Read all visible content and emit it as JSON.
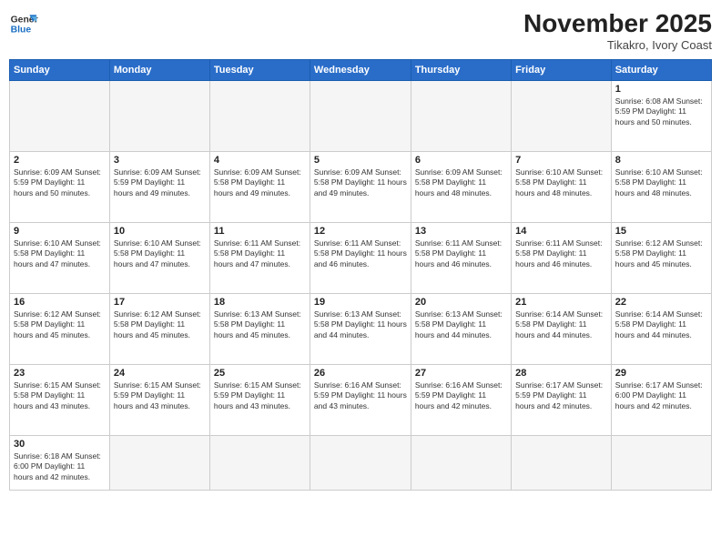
{
  "logo": {
    "general": "General",
    "blue": "Blue"
  },
  "header": {
    "title": "November 2025",
    "location": "Tikakro, Ivory Coast"
  },
  "weekdays": [
    "Sunday",
    "Monday",
    "Tuesday",
    "Wednesday",
    "Thursday",
    "Friday",
    "Saturday"
  ],
  "weeks": [
    [
      {
        "day": "",
        "info": ""
      },
      {
        "day": "",
        "info": ""
      },
      {
        "day": "",
        "info": ""
      },
      {
        "day": "",
        "info": ""
      },
      {
        "day": "",
        "info": ""
      },
      {
        "day": "",
        "info": ""
      },
      {
        "day": "1",
        "info": "Sunrise: 6:08 AM\nSunset: 5:59 PM\nDaylight: 11 hours\nand 50 minutes."
      }
    ],
    [
      {
        "day": "2",
        "info": "Sunrise: 6:09 AM\nSunset: 5:59 PM\nDaylight: 11 hours\nand 50 minutes."
      },
      {
        "day": "3",
        "info": "Sunrise: 6:09 AM\nSunset: 5:59 PM\nDaylight: 11 hours\nand 49 minutes."
      },
      {
        "day": "4",
        "info": "Sunrise: 6:09 AM\nSunset: 5:58 PM\nDaylight: 11 hours\nand 49 minutes."
      },
      {
        "day": "5",
        "info": "Sunrise: 6:09 AM\nSunset: 5:58 PM\nDaylight: 11 hours\nand 49 minutes."
      },
      {
        "day": "6",
        "info": "Sunrise: 6:09 AM\nSunset: 5:58 PM\nDaylight: 11 hours\nand 48 minutes."
      },
      {
        "day": "7",
        "info": "Sunrise: 6:10 AM\nSunset: 5:58 PM\nDaylight: 11 hours\nand 48 minutes."
      },
      {
        "day": "8",
        "info": "Sunrise: 6:10 AM\nSunset: 5:58 PM\nDaylight: 11 hours\nand 48 minutes."
      }
    ],
    [
      {
        "day": "9",
        "info": "Sunrise: 6:10 AM\nSunset: 5:58 PM\nDaylight: 11 hours\nand 47 minutes."
      },
      {
        "day": "10",
        "info": "Sunrise: 6:10 AM\nSunset: 5:58 PM\nDaylight: 11 hours\nand 47 minutes."
      },
      {
        "day": "11",
        "info": "Sunrise: 6:11 AM\nSunset: 5:58 PM\nDaylight: 11 hours\nand 47 minutes."
      },
      {
        "day": "12",
        "info": "Sunrise: 6:11 AM\nSunset: 5:58 PM\nDaylight: 11 hours\nand 46 minutes."
      },
      {
        "day": "13",
        "info": "Sunrise: 6:11 AM\nSunset: 5:58 PM\nDaylight: 11 hours\nand 46 minutes."
      },
      {
        "day": "14",
        "info": "Sunrise: 6:11 AM\nSunset: 5:58 PM\nDaylight: 11 hours\nand 46 minutes."
      },
      {
        "day": "15",
        "info": "Sunrise: 6:12 AM\nSunset: 5:58 PM\nDaylight: 11 hours\nand 45 minutes."
      }
    ],
    [
      {
        "day": "16",
        "info": "Sunrise: 6:12 AM\nSunset: 5:58 PM\nDaylight: 11 hours\nand 45 minutes."
      },
      {
        "day": "17",
        "info": "Sunrise: 6:12 AM\nSunset: 5:58 PM\nDaylight: 11 hours\nand 45 minutes."
      },
      {
        "day": "18",
        "info": "Sunrise: 6:13 AM\nSunset: 5:58 PM\nDaylight: 11 hours\nand 45 minutes."
      },
      {
        "day": "19",
        "info": "Sunrise: 6:13 AM\nSunset: 5:58 PM\nDaylight: 11 hours\nand 44 minutes."
      },
      {
        "day": "20",
        "info": "Sunrise: 6:13 AM\nSunset: 5:58 PM\nDaylight: 11 hours\nand 44 minutes."
      },
      {
        "day": "21",
        "info": "Sunrise: 6:14 AM\nSunset: 5:58 PM\nDaylight: 11 hours\nand 44 minutes."
      },
      {
        "day": "22",
        "info": "Sunrise: 6:14 AM\nSunset: 5:58 PM\nDaylight: 11 hours\nand 44 minutes."
      }
    ],
    [
      {
        "day": "23",
        "info": "Sunrise: 6:15 AM\nSunset: 5:58 PM\nDaylight: 11 hours\nand 43 minutes."
      },
      {
        "day": "24",
        "info": "Sunrise: 6:15 AM\nSunset: 5:59 PM\nDaylight: 11 hours\nand 43 minutes."
      },
      {
        "day": "25",
        "info": "Sunrise: 6:15 AM\nSunset: 5:59 PM\nDaylight: 11 hours\nand 43 minutes."
      },
      {
        "day": "26",
        "info": "Sunrise: 6:16 AM\nSunset: 5:59 PM\nDaylight: 11 hours\nand 43 minutes."
      },
      {
        "day": "27",
        "info": "Sunrise: 6:16 AM\nSunset: 5:59 PM\nDaylight: 11 hours\nand 42 minutes."
      },
      {
        "day": "28",
        "info": "Sunrise: 6:17 AM\nSunset: 5:59 PM\nDaylight: 11 hours\nand 42 minutes."
      },
      {
        "day": "29",
        "info": "Sunrise: 6:17 AM\nSunset: 6:00 PM\nDaylight: 11 hours\nand 42 minutes."
      }
    ],
    [
      {
        "day": "30",
        "info": "Sunrise: 6:18 AM\nSunset: 6:00 PM\nDaylight: 11 hours\nand 42 minutes."
      },
      {
        "day": "",
        "info": ""
      },
      {
        "day": "",
        "info": ""
      },
      {
        "day": "",
        "info": ""
      },
      {
        "day": "",
        "info": ""
      },
      {
        "day": "",
        "info": ""
      },
      {
        "day": "",
        "info": ""
      }
    ]
  ]
}
